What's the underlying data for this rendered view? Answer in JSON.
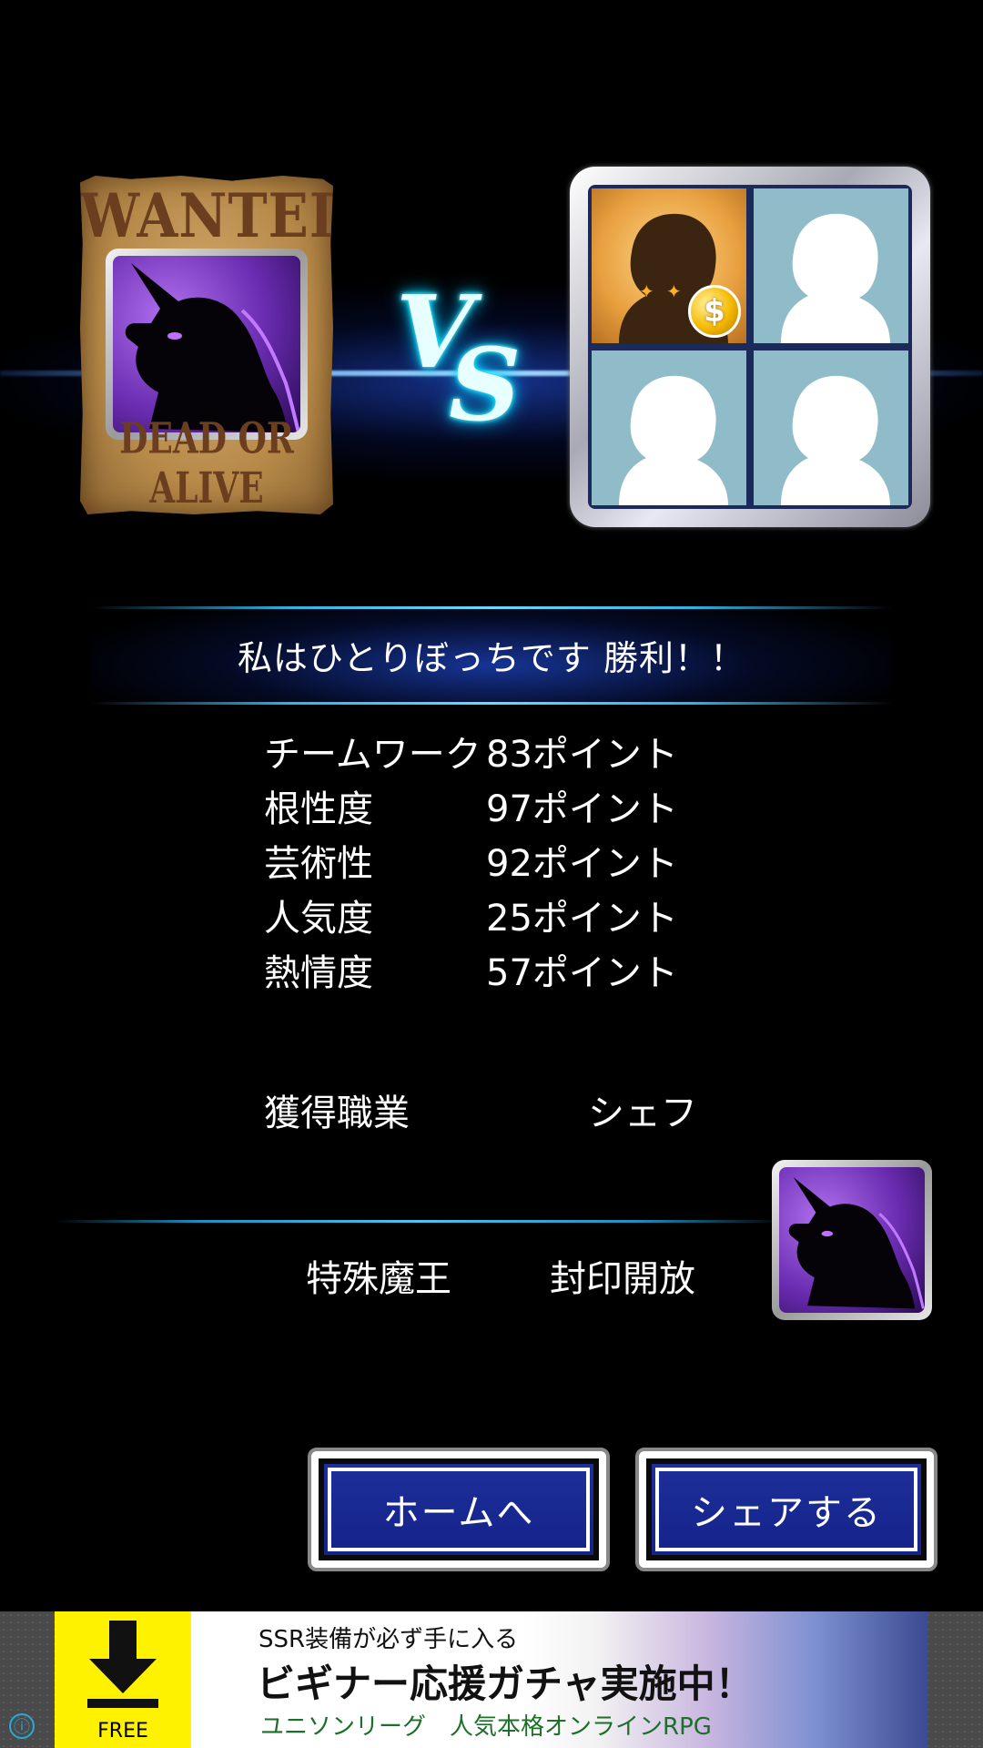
{
  "poster": {
    "title": "WANTED",
    "footer": "DEAD OR ALIVE"
  },
  "vs": {
    "v": "V",
    "s": "S"
  },
  "team": {
    "coin_symbol": "$"
  },
  "result": {
    "banner": "私はひとりぼっちです 勝利！！"
  },
  "stats": [
    {
      "label": "チームワーク",
      "value": "83ポイント"
    },
    {
      "label": "根性度",
      "value": "97ポイント"
    },
    {
      "label": "芸術性",
      "value": "92ポイント"
    },
    {
      "label": "人気度",
      "value": "25ポイント"
    },
    {
      "label": "熱情度",
      "value": "57ポイント"
    }
  ],
  "job": {
    "label": "獲得職業",
    "value": "シェフ"
  },
  "special": {
    "label": "特殊魔王",
    "value": "封印開放"
  },
  "buttons": {
    "home": "ホームへ",
    "share": "シェアする"
  },
  "ad": {
    "line1": "SSR装備が必ず手に入る",
    "line2": "ビギナー応援ガチャ実施中！",
    "line3": "ユニソンリーグ　人気本格オンラインRPG",
    "download_label": "FREE",
    "info_symbol": "ⓘ"
  },
  "colors": {
    "accent_glow": "#00e5ff",
    "button_blue": "#1e2f9a",
    "ad_yellow": "#fff200"
  }
}
